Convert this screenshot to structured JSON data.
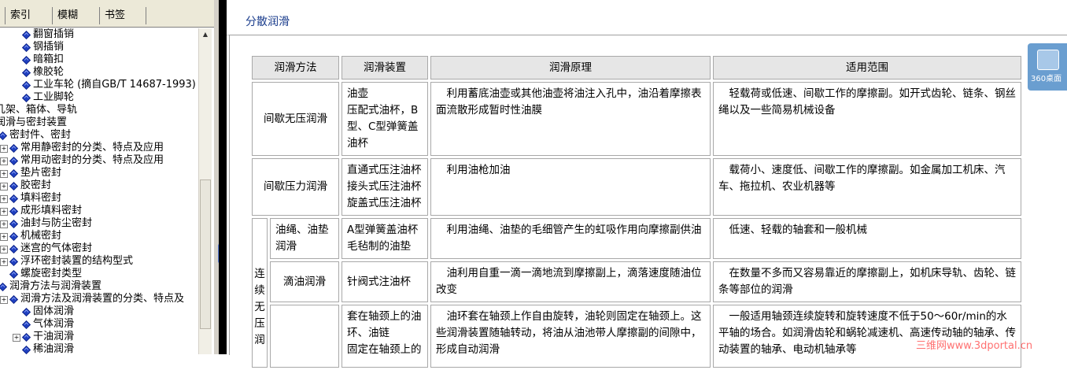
{
  "tabs": [
    "索引",
    "模糊",
    "书签"
  ],
  "tree": [
    {
      "label": "翻窗插销",
      "x": 26
    },
    {
      "label": "钢插销",
      "x": 26
    },
    {
      "label": "暗箱扣",
      "x": 26
    },
    {
      "label": "橡胶轮",
      "x": 26
    },
    {
      "label": "工业车轮 (摘自GB/T 14687-1993)",
      "x": 26
    },
    {
      "label": "工业脚轮",
      "x": 26
    },
    {
      "label": "几架、箱体、导轨",
      "x": -6,
      "plain": true
    },
    {
      "label": "润滑与密封装置",
      "x": -6,
      "plain": true
    },
    {
      "label": "密封件、密封",
      "x": -4,
      "folder": true
    },
    {
      "label": "常用静密封的分类、特点及应用",
      "x": 10,
      "exp": true
    },
    {
      "label": "常用动密封的分类、特点及应用",
      "x": 10,
      "exp": true
    },
    {
      "label": "垫片密封",
      "x": 10,
      "exp": true
    },
    {
      "label": "胶密封",
      "x": 10,
      "exp": true
    },
    {
      "label": "填料密封",
      "x": 10,
      "exp": true
    },
    {
      "label": "成形填料密封",
      "x": 10,
      "exp": true
    },
    {
      "label": "油封与防尘密封",
      "x": 10,
      "exp": true
    },
    {
      "label": "机械密封",
      "x": 10,
      "exp": true
    },
    {
      "label": "迷宫的气体密封",
      "x": 10,
      "exp": true
    },
    {
      "label": "浮环密封装置的结构型式",
      "x": 10,
      "exp": true
    },
    {
      "label": "螺旋密封类型",
      "x": 10
    },
    {
      "label": "润滑方法与润滑装置",
      "x": -4,
      "folder": true
    },
    {
      "label": "润滑方法及润滑装置的分类、特点及",
      "x": 10,
      "exp": true
    },
    {
      "label": "固体润滑",
      "x": 26
    },
    {
      "label": "气体润滑",
      "x": 26
    },
    {
      "label": "干油润滑",
      "x": 26,
      "exp": true
    },
    {
      "label": "稀油润滑",
      "x": 26
    }
  ],
  "page_title": "分散润滑",
  "table": {
    "headers": [
      "润滑方法",
      "润滑装置",
      "润滑原理",
      "适用范围"
    ],
    "rows": {
      "r1": {
        "method": "间歇无压润滑",
        "device": "油壶\n压配式油杯，B型、C型弹簧盖油杯",
        "principle": "利用蓄底油壶或其他油壶将油注入孔中，油沿着摩擦表面流散形成暂时性油膜",
        "scope": "轻载荷或低速、间歇工作的摩擦副。如开式齿轮、链条、钢丝绳以及一些简易机械设备"
      },
      "r2": {
        "method": "间歇压力润滑",
        "device": "直通式压注油杯\n接头式压注油杯\n旋盖式压注油杯",
        "principle": "利用油枪加油",
        "scope": "载荷小、速度低、间歇工作的摩擦副。如金属加工机床、汽车、拖拉机、农业机器等"
      },
      "group": "连续无压润",
      "r3": {
        "method": "油绳、油垫润滑",
        "device": "A型弹簧盖油杯\n毛毡制的油垫",
        "principle": "利用油绳、油垫的毛细管产生的虹吸作用向摩擦副供油",
        "scope": "低速、轻载的轴套和一般机械"
      },
      "r4": {
        "method": "滴油润滑",
        "device": "针阀式注油杯",
        "principle": "油利用自重一滴一滴地流到摩擦副上，滴落速度随油位改变",
        "scope": "在数量不多而又容易靠近的摩擦副上，如机床导轨、齿轮、链条等部位的润滑"
      },
      "r5": {
        "method": "",
        "device": "套在轴颈上的油环、油链\n固定在轴颈上的",
        "principle": "油环套在轴颈上作自由旋转，油轮则固定在轴颈上。这些润滑装置随轴转动，将油从油池带人摩擦副的间隙中，形成自动润滑",
        "scope": "一般适用轴颈连续旋转和旋转速度不低于50～60r/min的水平轴的场合。如润滑齿轮和蜗轮减速机、高速传动轴的轴承、传动装置的轴承、电动机轴承等"
      }
    }
  },
  "widget_label": "360桌面",
  "watermark": "三维网www.3dportal.cn"
}
